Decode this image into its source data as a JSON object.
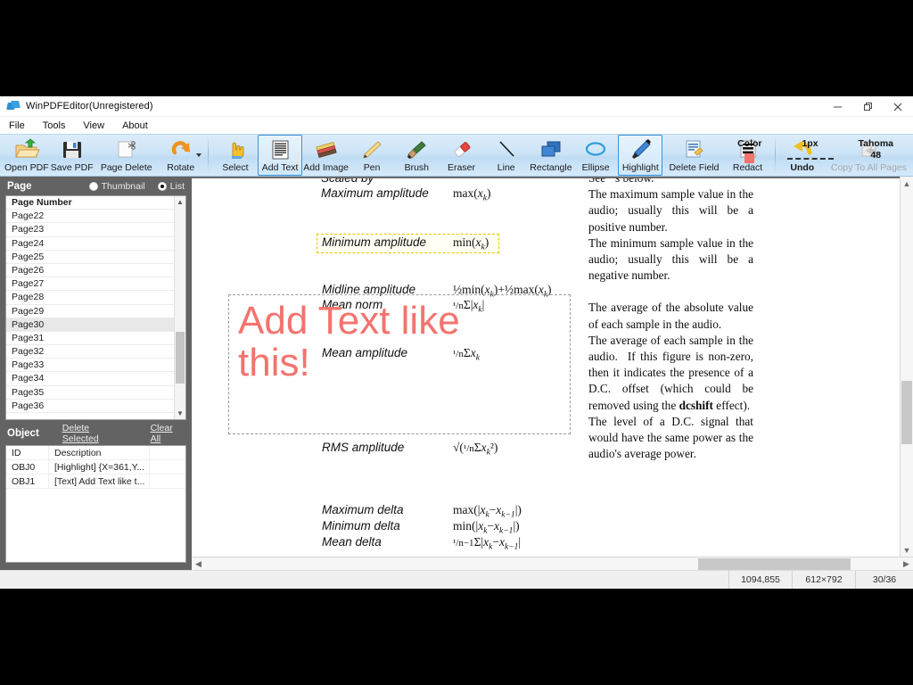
{
  "window": {
    "title": "WinPDFEditor(Unregistered)",
    "app_icon": "winpdfeditor-logo-icon",
    "minimize": "minimize-icon",
    "restore": "restore-icon",
    "close": "close-icon"
  },
  "menubar": {
    "items": [
      "File",
      "Tools",
      "View",
      "About"
    ]
  },
  "toolbar": {
    "items": [
      {
        "label": "Open PDF",
        "icon": "open-folder-icon",
        "selected": false,
        "disabled": false
      },
      {
        "label": "Save PDF",
        "icon": "floppy-disk-icon",
        "selected": false,
        "disabled": false
      },
      {
        "label": "Page Delete",
        "icon": "page-delete-icon",
        "selected": false,
        "disabled": false
      },
      {
        "label": "Rotate",
        "icon": "rotate-icon",
        "selected": false,
        "disabled": false,
        "has_dropdown": true
      },
      {
        "label": "Select",
        "icon": "hand-pointer-icon",
        "selected": false,
        "disabled": false,
        "sep_before": true
      },
      {
        "label": "Add Text",
        "icon": "add-text-icon",
        "selected": true,
        "disabled": false
      },
      {
        "label": "Add Image",
        "icon": "add-image-icon",
        "selected": false,
        "disabled": false
      },
      {
        "label": "Pen",
        "icon": "pen-icon",
        "selected": false,
        "disabled": false
      },
      {
        "label": "Brush",
        "icon": "brush-icon",
        "selected": false,
        "disabled": false
      },
      {
        "label": "Eraser",
        "icon": "eraser-icon",
        "selected": false,
        "disabled": false
      },
      {
        "label": "Line",
        "icon": "line-icon",
        "selected": false,
        "disabled": false
      },
      {
        "label": "Rectangle",
        "icon": "rectangle-icon",
        "selected": false,
        "disabled": false
      },
      {
        "label": "Ellipse",
        "icon": "ellipse-icon",
        "selected": false,
        "disabled": false
      },
      {
        "label": "Highlight",
        "icon": "highlighter-icon",
        "selected": true,
        "disabled": false
      },
      {
        "label": "Delete Field",
        "icon": "delete-field-icon",
        "selected": false,
        "disabled": false
      },
      {
        "label": "Redact",
        "icon": "redact-icon",
        "selected": false,
        "disabled": false
      },
      {
        "label": "Undo",
        "icon": "undo-arrow-icon",
        "selected": false,
        "disabled": false,
        "sep_before": true
      },
      {
        "label": "Copy To All Pages",
        "icon": "copy-to-all-pages-icon",
        "selected": false,
        "disabled": true
      }
    ],
    "properties": {
      "color_label": "Color",
      "color_value": "#f4736e",
      "width_label": "1px",
      "font_label": "Tahoma",
      "font_size": "48"
    }
  },
  "page_panel": {
    "title": "Page",
    "view_modes": [
      {
        "label": "Thumbnail",
        "selected": false
      },
      {
        "label": "List",
        "selected": true
      }
    ],
    "column_header": "Page Number",
    "pages": [
      {
        "label": "Page22",
        "selected": false
      },
      {
        "label": "Page23",
        "selected": false
      },
      {
        "label": "Page24",
        "selected": false
      },
      {
        "label": "Page25",
        "selected": false
      },
      {
        "label": "Page26",
        "selected": false
      },
      {
        "label": "Page27",
        "selected": false
      },
      {
        "label": "Page28",
        "selected": false
      },
      {
        "label": "Page29",
        "selected": false
      },
      {
        "label": "Page30",
        "selected": true
      },
      {
        "label": "Page31",
        "selected": false
      },
      {
        "label": "Page32",
        "selected": false
      },
      {
        "label": "Page33",
        "selected": false
      },
      {
        "label": "Page34",
        "selected": false
      },
      {
        "label": "Page35",
        "selected": false
      },
      {
        "label": "Page36",
        "selected": false
      }
    ]
  },
  "object_panel": {
    "title": "Object",
    "delete_selected_label": "Delete Selected",
    "clear_all_label": "Clear All",
    "columns": [
      "ID",
      "Description"
    ],
    "rows": [
      {
        "id": "OBJ0",
        "description": "[Highlight] {X=361,Y..."
      },
      {
        "id": "OBJ1",
        "description": "[Text] Add Text like t..."
      }
    ]
  },
  "document": {
    "left_column_rows": [
      {
        "term": "Scaled by",
        "formula": ""
      },
      {
        "term": "Maximum amplitude",
        "formula": "max(x_k)"
      },
      {
        "term": "Minimum amplitude",
        "formula": "min(x_k)"
      },
      {
        "term": "Midline amplitude",
        "formula": "½min(x_k)+½max(x_k)"
      },
      {
        "term": "Mean norm",
        "formula": "¹/nΣ|x_k|"
      },
      {
        "term": "Mean amplitude",
        "formula": "¹/nΣx_k"
      },
      {
        "term": "RMS amplitude",
        "formula": "√(¹/nΣx_k²)"
      },
      {
        "term": "Maximum delta",
        "formula": "max(|x_k−x_k−1|)"
      },
      {
        "term": "Minimum delta",
        "formula": "min(|x_k−x_k−1|)"
      },
      {
        "term": "Mean delta",
        "formula": "¹/n−1Σ|x_k−x_k−1|"
      }
    ],
    "right_column_paragraphs": [
      "See −s below.",
      "The maximum sample value in the audio; usually this will be a positive number.",
      "The minimum sample value in the audio; usually this will be a negative number.",
      "The average of the absolute value of each sample in the audio.",
      "The average of each sample in the audio.  If this figure is non-zero, then it indicates the presence of a D.C. offset (which could be removed using the dcshift effect).",
      "The level of a D.C. signal that would have the same power as the audio's average power."
    ],
    "annotations": {
      "highlight_note": "Minimum amplitude row highlight",
      "added_text_line1": "Add Text like",
      "added_text_line2": "this!",
      "added_text_color": "#f4736e"
    }
  },
  "statusbar": {
    "cursor_position": "1094,855",
    "page_size": "612×792",
    "page_index": "30/36"
  }
}
